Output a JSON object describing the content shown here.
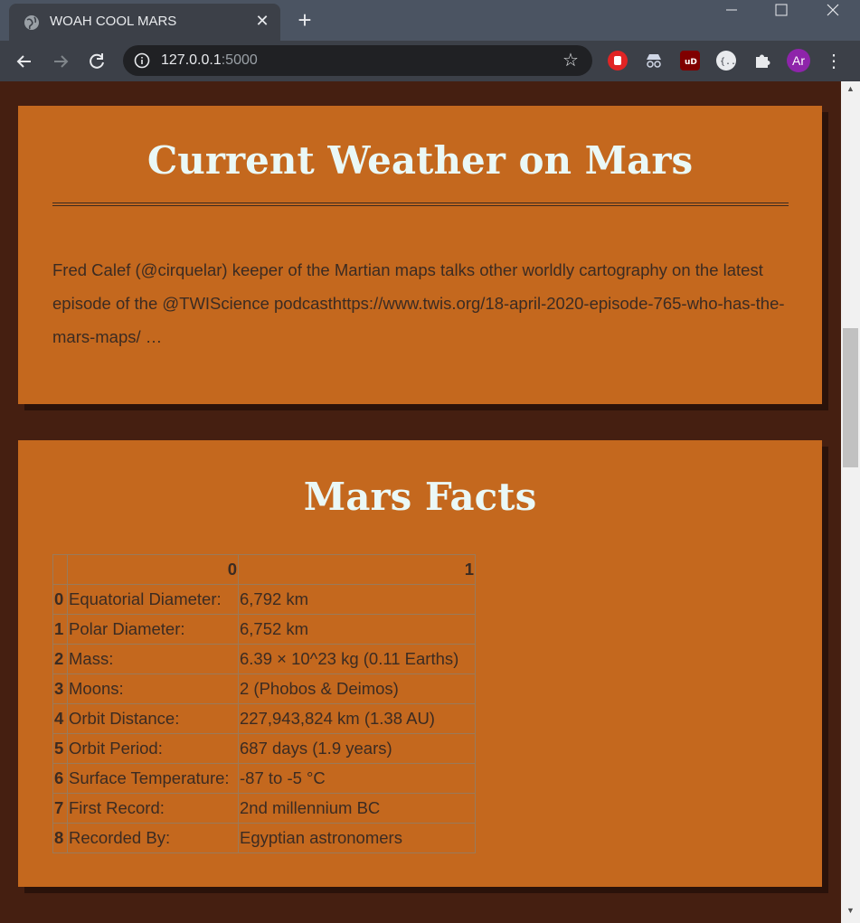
{
  "browser": {
    "tab_title": "WOAH COOL MARS",
    "url_host": "127.0.0.1",
    "url_port": ":5000",
    "avatar_initials": "Ar"
  },
  "weather": {
    "title": "Current Weather on Mars",
    "tweet": "Fred Calef (@cirquelar) keeper of the Martian maps talks other worldly cartography on the latest episode of the @TWIScience podcasthttps://www.twis.org/18-april-2020-episode-765-who-has-the-mars-maps/ …"
  },
  "facts": {
    "title": "Mars Facts",
    "header": [
      "",
      "0",
      "1"
    ],
    "rows": [
      {
        "index": "0",
        "label": "Equatorial Diameter:",
        "value": "6,792 km"
      },
      {
        "index": "1",
        "label": "Polar Diameter:",
        "value": "6,752 km"
      },
      {
        "index": "2",
        "label": "Mass:",
        "value": "6.39 × 10^23 kg (0.11 Earths)"
      },
      {
        "index": "3",
        "label": "Moons:",
        "value": "2 (Phobos & Deimos)"
      },
      {
        "index": "4",
        "label": "Orbit Distance:",
        "value": "227,943,824 km (1.38 AU)"
      },
      {
        "index": "5",
        "label": "Orbit Period:",
        "value": "687 days (1.9 years)"
      },
      {
        "index": "6",
        "label": "Surface Temperature:",
        "value": "-87 to -5 °C"
      },
      {
        "index": "7",
        "label": "First Record:",
        "value": "2nd millennium BC"
      },
      {
        "index": "8",
        "label": "Recorded By:",
        "value": "Egyptian astronomers"
      }
    ]
  },
  "colors": {
    "page_bg": "#451f11",
    "card_bg": "#c4681e",
    "title_text": "#eaf8f6",
    "body_text": "#3b2b22"
  }
}
